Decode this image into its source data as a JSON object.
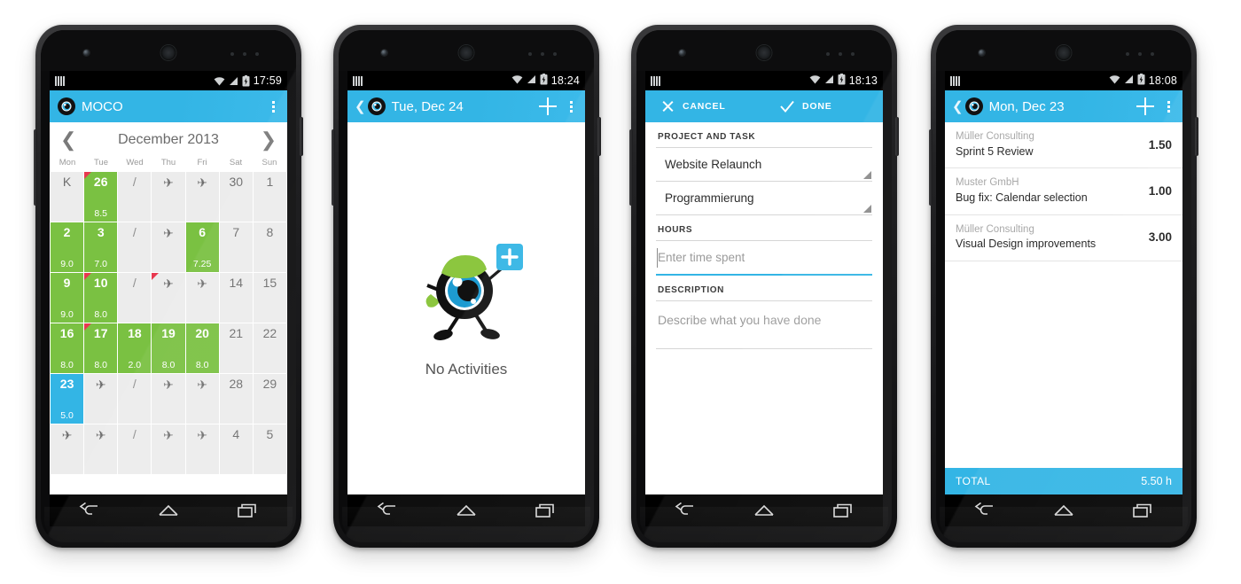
{
  "meta": {
    "accent_blue": "#33b5e5",
    "accent_green": "#7ac142",
    "flag_red": "#e8384f",
    "cell_grey": "#ececec"
  },
  "phones": [
    {
      "id": "calendar",
      "status": {
        "time": "17:59",
        "wifi_icon": "wifi-icon",
        "signal_icon": "signal-icon",
        "battery_icon": "battery-charging-icon"
      },
      "appbar": {
        "title": "MOCO",
        "logo_icon": "moco-logo-icon",
        "overflow_icon": "overflow-menu-icon",
        "has_back": false,
        "has_plus": false
      },
      "calendar": {
        "prev_icon": "chevron-left-icon",
        "next_icon": "chevron-right-icon",
        "month": "December 2013",
        "weekdays": [
          "Mon",
          "Tue",
          "Wed",
          "Thu",
          "Fri",
          "Sat",
          "Sun"
        ],
        "cells": [
          {
            "label": "K",
            "type": "plain",
            "hours": "",
            "flag": false
          },
          {
            "label": "26",
            "type": "green",
            "hours": "8.5",
            "flag": true
          },
          {
            "label": "/",
            "type": "slash",
            "hours": "",
            "flag": false
          },
          {
            "label": "plane",
            "type": "plane",
            "hours": "",
            "flag": false
          },
          {
            "label": "plane",
            "type": "plane",
            "hours": "",
            "flag": false
          },
          {
            "label": "30",
            "type": "plain",
            "hours": "",
            "flag": false
          },
          {
            "label": "1",
            "type": "plain",
            "hours": "",
            "flag": false
          },
          {
            "label": "2",
            "type": "green",
            "hours": "9.0",
            "flag": false
          },
          {
            "label": "3",
            "type": "green",
            "hours": "7.0",
            "flag": false
          },
          {
            "label": "/",
            "type": "slash",
            "hours": "",
            "flag": false
          },
          {
            "label": "plane",
            "type": "plane",
            "hours": "",
            "flag": false
          },
          {
            "label": "6",
            "type": "green",
            "hours": "7.25",
            "flag": false
          },
          {
            "label": "7",
            "type": "plain",
            "hours": "",
            "flag": false
          },
          {
            "label": "8",
            "type": "plain",
            "hours": "",
            "flag": false
          },
          {
            "label": "9",
            "type": "green",
            "hours": "9.0",
            "flag": false
          },
          {
            "label": "10",
            "type": "green",
            "hours": "8.0",
            "flag": true
          },
          {
            "label": "/",
            "type": "slash",
            "hours": "",
            "flag": false
          },
          {
            "label": "plane",
            "type": "plane",
            "hours": "",
            "flag": true
          },
          {
            "label": "plane",
            "type": "plane",
            "hours": "",
            "flag": false
          },
          {
            "label": "14",
            "type": "plain",
            "hours": "",
            "flag": false
          },
          {
            "label": "15",
            "type": "plain",
            "hours": "",
            "flag": false
          },
          {
            "label": "16",
            "type": "green",
            "hours": "8.0",
            "flag": false
          },
          {
            "label": "17",
            "type": "green",
            "hours": "8.0",
            "flag": true
          },
          {
            "label": "18",
            "type": "green",
            "hours": "2.0",
            "flag": false
          },
          {
            "label": "19",
            "type": "green",
            "hours": "8.0",
            "flag": false
          },
          {
            "label": "20",
            "type": "green",
            "hours": "8.0",
            "flag": false
          },
          {
            "label": "21",
            "type": "plain",
            "hours": "",
            "flag": false
          },
          {
            "label": "22",
            "type": "plain",
            "hours": "",
            "flag": false
          },
          {
            "label": "23",
            "type": "blue",
            "hours": "5.0",
            "flag": false
          },
          {
            "label": "plane",
            "type": "plane",
            "hours": "",
            "flag": false
          },
          {
            "label": "/",
            "type": "slash",
            "hours": "",
            "flag": false
          },
          {
            "label": "plane",
            "type": "plane",
            "hours": "",
            "flag": false
          },
          {
            "label": "plane",
            "type": "plane",
            "hours": "",
            "flag": false
          },
          {
            "label": "28",
            "type": "plain",
            "hours": "",
            "flag": false
          },
          {
            "label": "29",
            "type": "plain",
            "hours": "",
            "flag": false
          },
          {
            "label": "plane",
            "type": "plane",
            "hours": "",
            "flag": false
          },
          {
            "label": "plane",
            "type": "plane",
            "hours": "",
            "flag": false
          },
          {
            "label": "/",
            "type": "slash",
            "hours": "",
            "flag": false
          },
          {
            "label": "plane",
            "type": "plane",
            "hours": "",
            "flag": false
          },
          {
            "label": "plane",
            "type": "plane",
            "hours": "",
            "flag": false
          },
          {
            "label": "4",
            "type": "plain",
            "hours": "",
            "flag": false
          },
          {
            "label": "5",
            "type": "plain",
            "hours": "",
            "flag": false
          }
        ]
      }
    },
    {
      "id": "empty-day",
      "status": {
        "time": "18:24"
      },
      "appbar": {
        "title": "Tue, Dec 24",
        "logo_icon": "moco-logo-icon",
        "overflow_icon": "overflow-menu-icon",
        "has_back": true,
        "has_plus": true,
        "plus_icon": "plus-icon",
        "back_icon": "chevron-left-icon"
      },
      "empty": {
        "label": "No Activities",
        "illustration_icon": "moco-mascot-illustration"
      }
    },
    {
      "id": "new-activity",
      "status": {
        "time": "18:13"
      },
      "actionbar": {
        "cancel_label": "CANCEL",
        "cancel_icon": "close-icon",
        "done_label": "DONE",
        "done_icon": "check-icon"
      },
      "form": {
        "section_project": "PROJECT AND TASK",
        "project_value": "Website Relaunch",
        "task_value": "Programmierung",
        "section_hours": "HOURS",
        "hours_placeholder": "Enter time spent",
        "hours_value": "",
        "section_description": "DESCRIPTION",
        "description_placeholder": "Describe what you have done",
        "description_value": "",
        "dropdown_icon": "dropdown-triangle-icon"
      }
    },
    {
      "id": "day-activities",
      "status": {
        "time": "18:08"
      },
      "appbar": {
        "title": "Mon, Dec 23",
        "logo_icon": "moco-logo-icon",
        "overflow_icon": "overflow-menu-icon",
        "has_back": true,
        "has_plus": true,
        "plus_icon": "plus-icon",
        "back_icon": "chevron-left-icon"
      },
      "activities": [
        {
          "client": "Müller Consulting",
          "task": "Sprint 5 Review",
          "hours": "1.50"
        },
        {
          "client": "Muster GmbH",
          "task": "Bug fix: Calendar selection",
          "hours": "1.00"
        },
        {
          "client": "Müller Consulting",
          "task": "Visual Design improvements",
          "hours": "3.00"
        }
      ],
      "total": {
        "label": "TOTAL",
        "value": "5.50 h"
      }
    }
  ],
  "navbar": {
    "back_icon": "nav-back-icon",
    "home_icon": "nav-home-icon",
    "recents_icon": "nav-recents-icon"
  }
}
